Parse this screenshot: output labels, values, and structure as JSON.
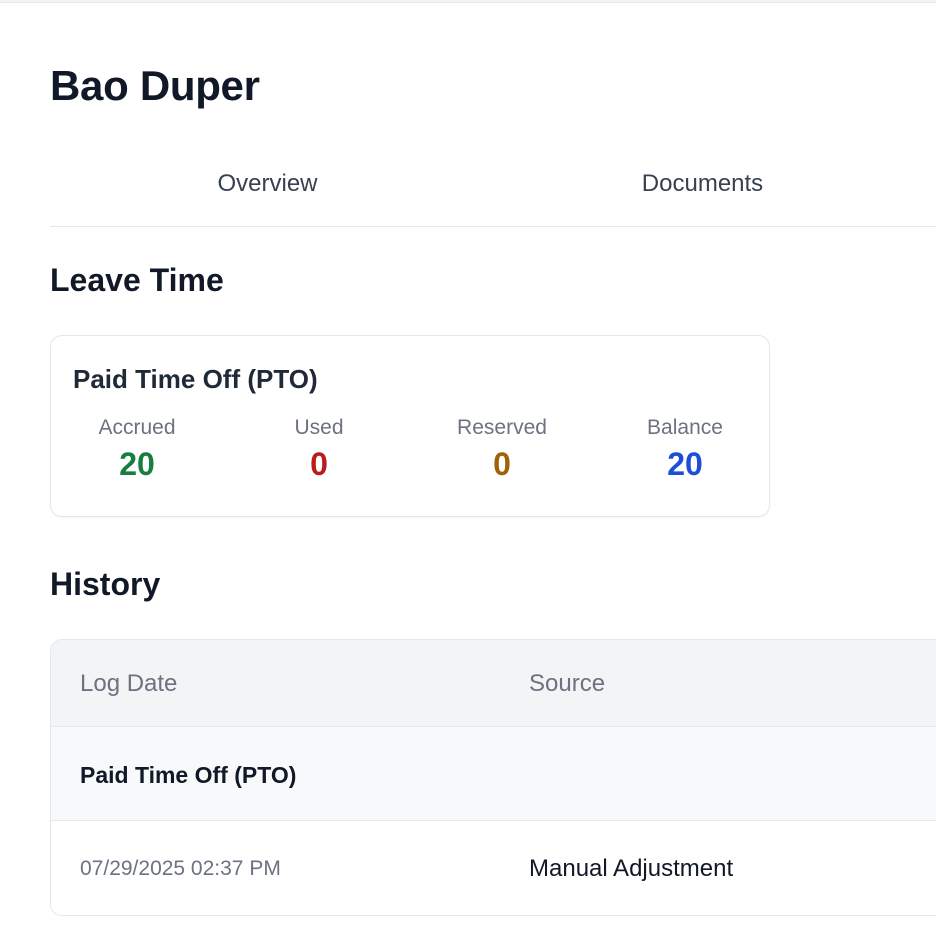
{
  "employee": {
    "name": "Bao Duper"
  },
  "tabs": [
    {
      "label": "Overview"
    },
    {
      "label": "Documents"
    }
  ],
  "leave": {
    "section_title": "Leave Time",
    "card": {
      "title": "Paid Time Off (PTO)",
      "stats": [
        {
          "label": "Accrued",
          "value": "20",
          "color": "#15803d"
        },
        {
          "label": "Used",
          "value": "0",
          "color": "#b91c1c"
        },
        {
          "label": "Reserved",
          "value": "0",
          "color": "#a16207"
        },
        {
          "label": "Balance",
          "value": "20",
          "color": "#1d4ed8"
        }
      ]
    }
  },
  "history": {
    "section_title": "History",
    "columns": [
      "Log Date",
      "Source"
    ],
    "groups": [
      {
        "label": "Paid Time Off (PTO)",
        "rows": [
          {
            "log_date": "07/29/2025 02:37 PM",
            "source": "Manual Adjustment"
          }
        ]
      }
    ]
  }
}
